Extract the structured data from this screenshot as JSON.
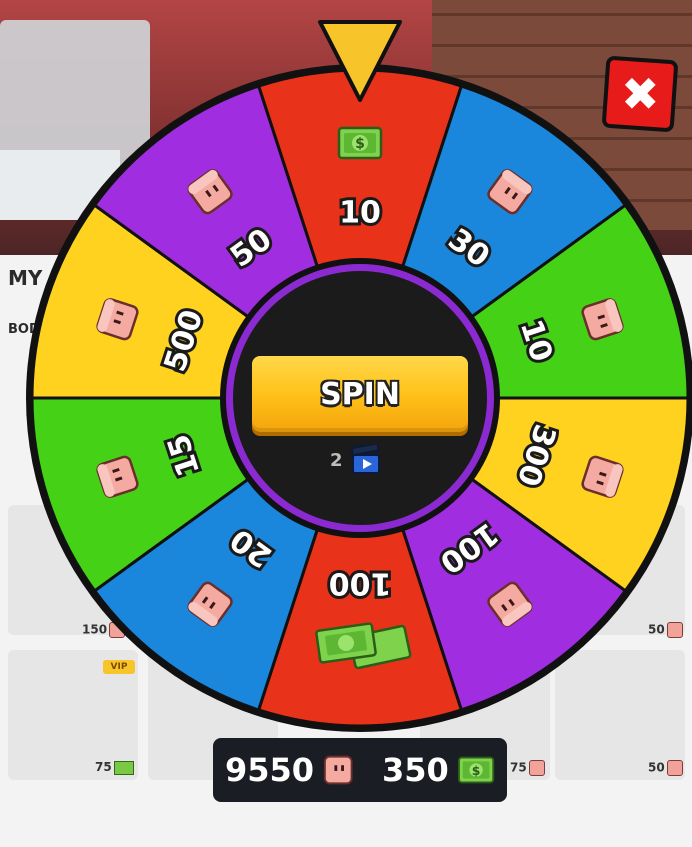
{
  "wheel": {
    "segments": [
      {
        "value": "10",
        "reward": "cash-icon",
        "color": "#e8321a"
      },
      {
        "value": "30",
        "reward": "cube-icon",
        "color": "#1a86dc"
      },
      {
        "value": "10",
        "reward": "cube-icon",
        "color": "#45d216"
      },
      {
        "value": "300",
        "reward": "cube-icon",
        "color": "#ffd21f"
      },
      {
        "value": "100",
        "reward": "cube-icon",
        "color": "#a02ee0"
      },
      {
        "value": "100",
        "reward": "cash-stack-icon",
        "color": "#e8321a"
      },
      {
        "value": "20",
        "reward": "cube-icon",
        "color": "#1a86dc"
      },
      {
        "value": "15",
        "reward": "cube-icon",
        "color": "#45d216"
      },
      {
        "value": "500",
        "reward": "cube-icon",
        "color": "#ffd21f"
      },
      {
        "value": "50",
        "reward": "cube-icon",
        "color": "#a02ee0"
      }
    ],
    "pointer_color": "#f7c52a",
    "hub_color": "#1b1b1b",
    "hub_ring_color": "#8a2ad0"
  },
  "spin": {
    "label": "SPIN",
    "count": "2"
  },
  "currency": {
    "cubes": "9550",
    "cash": "350"
  },
  "background": {
    "section_title": "MY",
    "section_tab": "BOD",
    "prices": [
      "150",
      "50",
      "75",
      "75",
      "50"
    ],
    "vip_badge": "VIP"
  }
}
